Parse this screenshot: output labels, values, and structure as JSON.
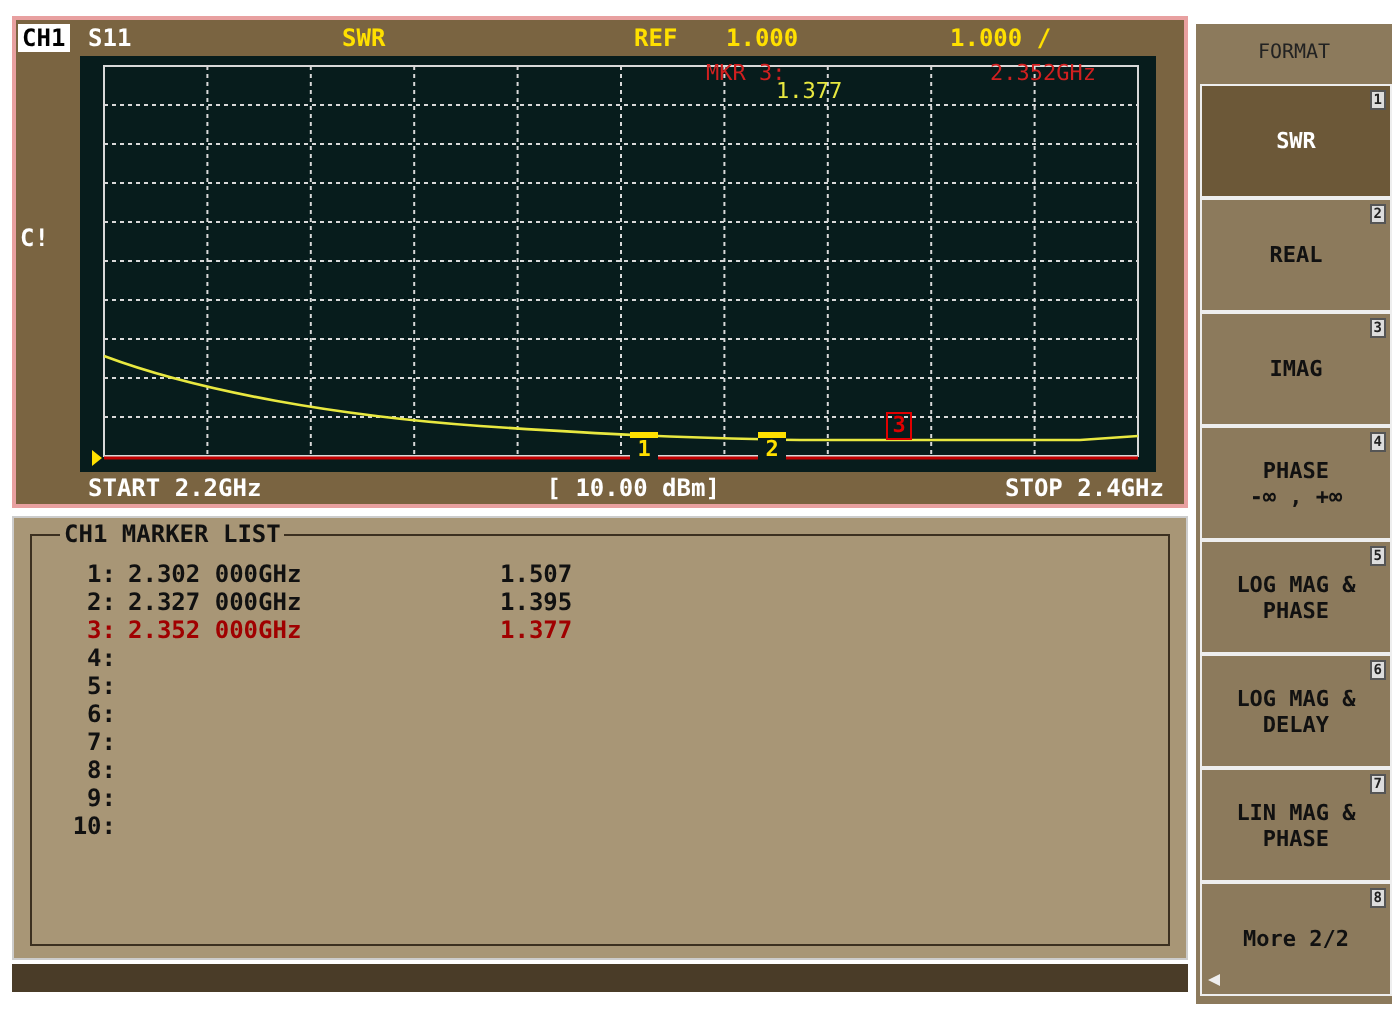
{
  "channel": {
    "label": "CH1",
    "parameter": "S11",
    "format": "SWR",
    "ref": "REF",
    "ref_value": "1.000",
    "scale": "1.000 /"
  },
  "marker_readout": {
    "label": "MKR 3:",
    "frequency": "2.352GHz",
    "value": "1.377"
  },
  "side_label": "C!",
  "trace_markers": [
    {
      "label": "1",
      "active": false
    },
    {
      "label": "2",
      "active": false
    },
    {
      "label": "3",
      "active": true
    }
  ],
  "sweep": {
    "start": "START 2.2GHz",
    "power": "[ 10.00 dBm]",
    "stop": "STOP 2.4GHz"
  },
  "marker_list": {
    "title": "CH1 MARKER LIST",
    "rows": [
      {
        "index": "1:",
        "frequency": "2.302 000GHz",
        "value": "1.507",
        "active": false
      },
      {
        "index": "2:",
        "frequency": "2.327 000GHz",
        "value": "1.395",
        "active": false
      },
      {
        "index": "3:",
        "frequency": "2.352 000GHz",
        "value": "1.377",
        "active": true
      },
      {
        "index": "4:",
        "active": false
      },
      {
        "index": "5:",
        "active": false
      },
      {
        "index": "6:",
        "active": false
      },
      {
        "index": "7:",
        "active": false
      },
      {
        "index": "8:",
        "active": false
      },
      {
        "index": "9:",
        "active": false
      },
      {
        "index": "10:",
        "active": false
      }
    ]
  },
  "softkeys": {
    "title": "FORMAT",
    "keys": [
      {
        "lines": [
          "SWR"
        ],
        "number": "1",
        "selected": true
      },
      {
        "lines": [
          "REAL"
        ],
        "number": "2",
        "selected": false
      },
      {
        "lines": [
          "IMAG"
        ],
        "number": "3",
        "selected": false
      },
      {
        "lines": [
          "PHASE",
          "-∞ , +∞"
        ],
        "number": "4",
        "selected": false
      },
      {
        "lines": [
          "LOG MAG &",
          "PHASE"
        ],
        "number": "5",
        "selected": false
      },
      {
        "lines": [
          "LOG MAG &",
          "DELAY"
        ],
        "number": "6",
        "selected": false
      },
      {
        "lines": [
          "LIN MAG &",
          "PHASE"
        ],
        "number": "7",
        "selected": false
      },
      {
        "lines": [
          "More 2/2"
        ],
        "number": "8",
        "selected": false,
        "back": true
      }
    ]
  }
}
